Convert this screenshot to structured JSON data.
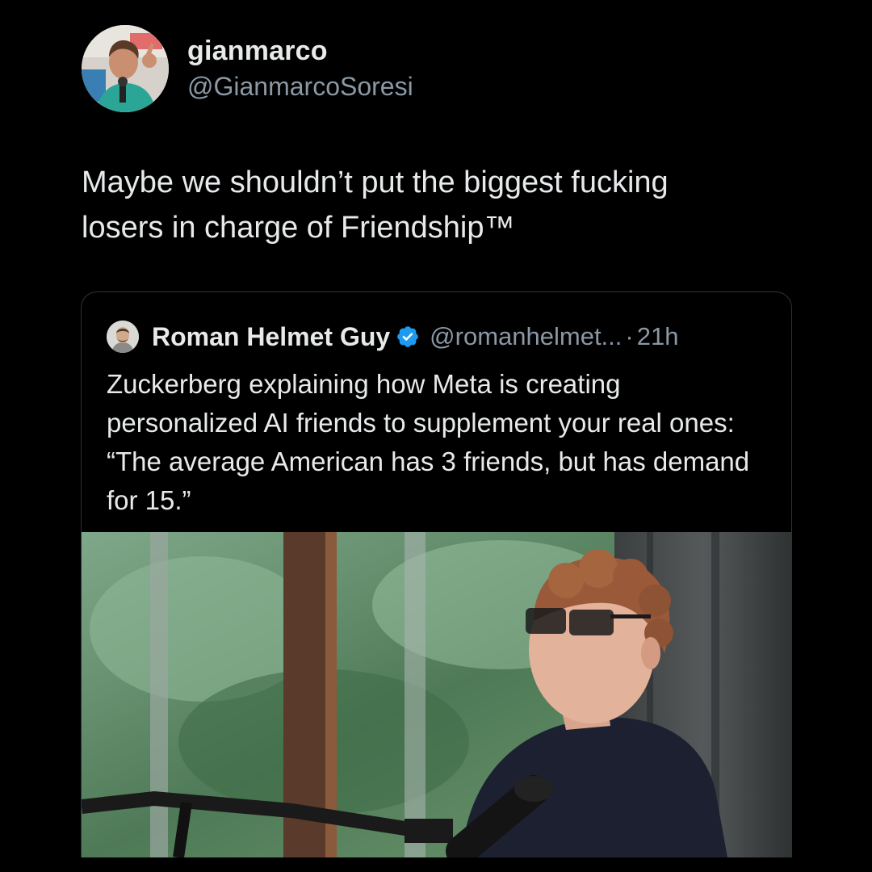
{
  "tweet": {
    "author": {
      "display_name": "gianmarco",
      "handle": "@GianmarcoSoresi",
      "avatar_icon": "user-avatar-icon"
    },
    "text": "Maybe we shouldn’t put the biggest fucking\nlosers in charge of Friendship™"
  },
  "quoted_tweet": {
    "author": {
      "display_name": "Roman Helmet Guy",
      "handle": "@romanhelmet...",
      "verified": true,
      "avatar_icon": "user-avatar-icon"
    },
    "separator": "·",
    "time": "21h",
    "text": "Zuckerberg explaining how Meta is creating personalized AI friends to supplement your real ones: “The average American has 3 friends, but has demand for 15.”",
    "media": {
      "type": "video-still"
    }
  },
  "colors": {
    "background": "#000000",
    "primary_text": "#e7e9ea",
    "secondary_text": "#8b98a5",
    "border": "#2f3336",
    "verified_badge": "#1d9bf0"
  }
}
